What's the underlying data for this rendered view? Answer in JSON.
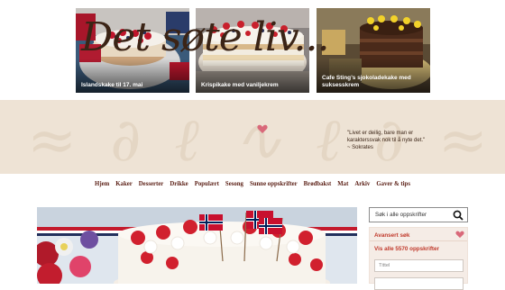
{
  "featured": [
    {
      "caption": "Islandskake til 17. mai"
    },
    {
      "caption": "Krispikake med vaniljekrem"
    },
    {
      "caption": "Cafe Sting’s sjokoladekake med suksesskrem"
    }
  ],
  "banner": {
    "logo": "Det søte liv...",
    "quote_text": "\"Livet er deilig, bare man er karakterssvak nok til å nyte det.\"",
    "quote_author": "~ Sokrates",
    "accent_color": "#d9697a"
  },
  "nav": [
    "Hjem",
    "Kaker",
    "Desserter",
    "Drikke",
    "Populært",
    "Sesong",
    "Sunne oppskrifter",
    "Brødbakst",
    "Mat",
    "Arkiv",
    "Gaver & tips"
  ],
  "sidebar": {
    "search_placeholder": "Søk i alle oppskrifter",
    "advanced_title": "Avansert søk",
    "show_all": "Vis alle 5570 oppskrifter",
    "title_placeholder": "Tittel"
  },
  "colors": {
    "nav_text": "#5a1e14",
    "brand_red": "#c0392b",
    "banner_bg": "#eee3d5"
  }
}
